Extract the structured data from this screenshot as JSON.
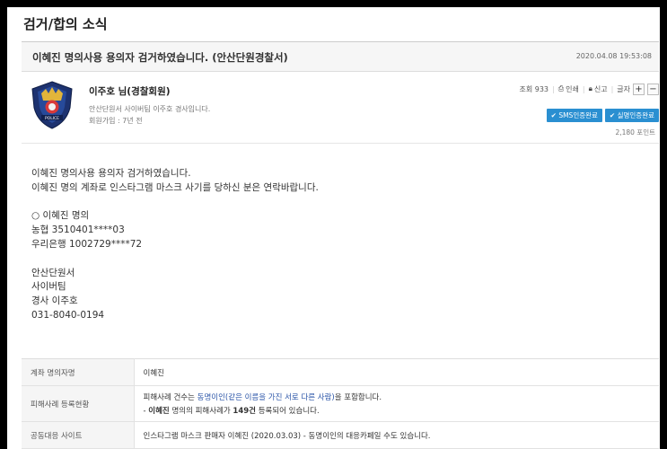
{
  "board": {
    "title": "검거/합의 소식"
  },
  "post": {
    "title": "이혜진 명의사용 용의자 검거하였습니다. (안산단원경찰서)",
    "date": "2020.04.08 19:53:08"
  },
  "author": {
    "name": "이주호 님(경찰회원)",
    "description": "안산단원서 사이버팀 이주호 경사입니다.",
    "joined": "회원가입 : 7년 전",
    "badge_text": "POLICE",
    "points": "2,180 포인트"
  },
  "toolbar": {
    "views": "조회 933",
    "print": "인쇄",
    "report": "신고",
    "font": "글자",
    "plus": "+",
    "minus": "−"
  },
  "certs": {
    "sms": "SMS인증완료",
    "realname": "실명인증완료"
  },
  "content": {
    "lines": [
      "이혜진 명의사용 용의자 검거하였습니다.",
      "이혜진 명의 계좌로 인스타그램 마스크 사기를 당하신 분은 연락바랍니다.",
      "",
      "○ 이혜진 명의",
      "농협 3510401****03",
      "우리은행 1002729****72",
      "",
      "안산단원서",
      "사이버팀",
      "경사 이주호",
      "031-8040-0194"
    ]
  },
  "info": {
    "rows": [
      {
        "label": "계좌 명의자명",
        "value": "이혜진"
      },
      {
        "label": "피해사례 등록현황",
        "line1_pre": "피해사례 건수는 ",
        "line1_hl": "동명이인(같은 이름을 가진 서로 다른 사람)",
        "line1_post": "을 포함합니다.",
        "line2_pre": "- ",
        "line2_name": "이혜진",
        "line2_mid": " 명의의 피해사례가 ",
        "line2_count": "149건",
        "line2_post": " 등록되어 있습니다."
      },
      {
        "label": "공동대응 사이트",
        "value": "인스타그램 마스크 판매자 이혜진 (2020.03.03) - 동명이인의 대응카페일 수도 있습니다."
      }
    ]
  }
}
